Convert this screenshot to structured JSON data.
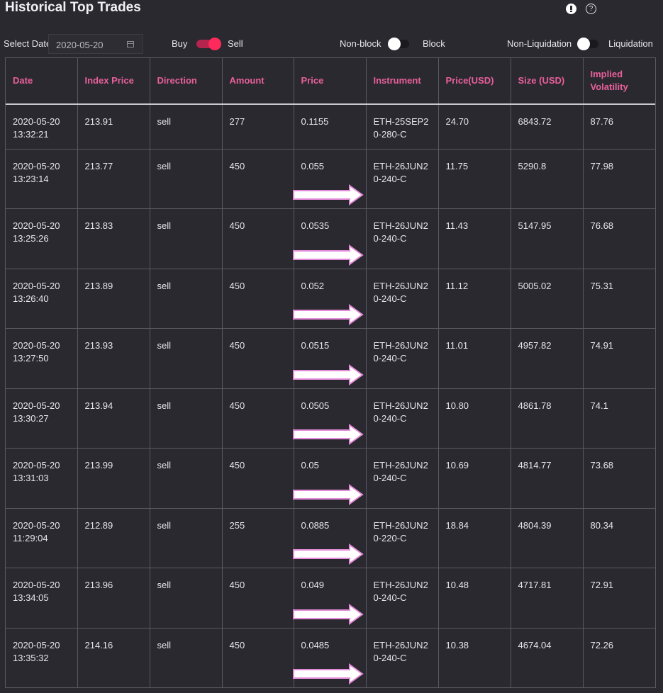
{
  "header": {
    "title": "Historical Top Trades",
    "info_icon": "info-icon",
    "help_icon": "help-icon"
  },
  "controls": {
    "select_date_label": "Select Date",
    "date_value": "2020-05-20",
    "buy_label": "Buy",
    "sell_label": "Sell",
    "nonblock_label": "Non-block",
    "block_label": "Block",
    "nonliq_label": "Non-Liquidation",
    "liq_label": "Liquidation",
    "direction_toggle_on": true,
    "block_toggle_on": false,
    "liquidation_toggle_on": false
  },
  "colors": {
    "accent": "#ff2a5c",
    "header_text": "#e8609a",
    "background": "#2a2930",
    "arrow_fill": "#ffffff",
    "arrow_stroke": "#e38bd9"
  },
  "table": {
    "columns": [
      "Date",
      "Index Price",
      "Direction",
      "Amount",
      "Price",
      "Instrument",
      "Price(USD)",
      "Size (USD)",
      "Implied Volatility"
    ],
    "rows": [
      {
        "date": "2020-05-20",
        "time": "13:32:21",
        "index_price": "213.91",
        "direction": "sell",
        "amount": "277",
        "price": "0.1155",
        "instrument": "ETH-25SEP20-280-C",
        "price_usd": "24.70",
        "size_usd": "6843.72",
        "iv": "87.76",
        "highlighted": false
      },
      {
        "date": "2020-05-20",
        "time": "13:23:14",
        "index_price": "213.77",
        "direction": "sell",
        "amount": "450",
        "price": "0.055",
        "instrument": "ETH-26JUN20-240-C",
        "price_usd": "11.75",
        "size_usd": "5290.8",
        "iv": "77.98",
        "highlighted": true
      },
      {
        "date": "2020-05-20",
        "time": "13:25:26",
        "index_price": "213.83",
        "direction": "sell",
        "amount": "450",
        "price": "0.0535",
        "instrument": "ETH-26JUN20-240-C",
        "price_usd": "11.43",
        "size_usd": "5147.95",
        "iv": "76.68",
        "highlighted": true
      },
      {
        "date": "2020-05-20",
        "time": "13:26:40",
        "index_price": "213.89",
        "direction": "sell",
        "amount": "450",
        "price": "0.052",
        "instrument": "ETH-26JUN20-240-C",
        "price_usd": "11.12",
        "size_usd": "5005.02",
        "iv": "75.31",
        "highlighted": true
      },
      {
        "date": "2020-05-20",
        "time": "13:27:50",
        "index_price": "213.93",
        "direction": "sell",
        "amount": "450",
        "price": "0.0515",
        "instrument": "ETH-26JUN20-240-C",
        "price_usd": "11.01",
        "size_usd": "4957.82",
        "iv": "74.91",
        "highlighted": true
      },
      {
        "date": "2020-05-20",
        "time": "13:30:27",
        "index_price": "213.94",
        "direction": "sell",
        "amount": "450",
        "price": "0.0505",
        "instrument": "ETH-26JUN20-240-C",
        "price_usd": "10.80",
        "size_usd": "4861.78",
        "iv": "74.1",
        "highlighted": true
      },
      {
        "date": "2020-05-20",
        "time": "13:31:03",
        "index_price": "213.99",
        "direction": "sell",
        "amount": "450",
        "price": "0.05",
        "instrument": "ETH-26JUN20-240-C",
        "price_usd": "10.69",
        "size_usd": "4814.77",
        "iv": "73.68",
        "highlighted": true
      },
      {
        "date": "2020-05-20",
        "time": "11:29:04",
        "index_price": "212.89",
        "direction": "sell",
        "amount": "255",
        "price": "0.0885",
        "instrument": "ETH-26JUN20-220-C",
        "price_usd": "18.84",
        "size_usd": "4804.39",
        "iv": "80.34",
        "highlighted": true
      },
      {
        "date": "2020-05-20",
        "time": "13:34:05",
        "index_price": "213.96",
        "direction": "sell",
        "amount": "450",
        "price": "0.049",
        "instrument": "ETH-26JUN20-240-C",
        "price_usd": "10.48",
        "size_usd": "4717.81",
        "iv": "72.91",
        "highlighted": true
      },
      {
        "date": "2020-05-20",
        "time": "13:35:32",
        "index_price": "214.16",
        "direction": "sell",
        "amount": "450",
        "price": "0.0485",
        "instrument": "ETH-26JUN20-240-C",
        "price_usd": "10.38",
        "size_usd": "4674.04",
        "iv": "72.26",
        "highlighted": true
      }
    ]
  }
}
